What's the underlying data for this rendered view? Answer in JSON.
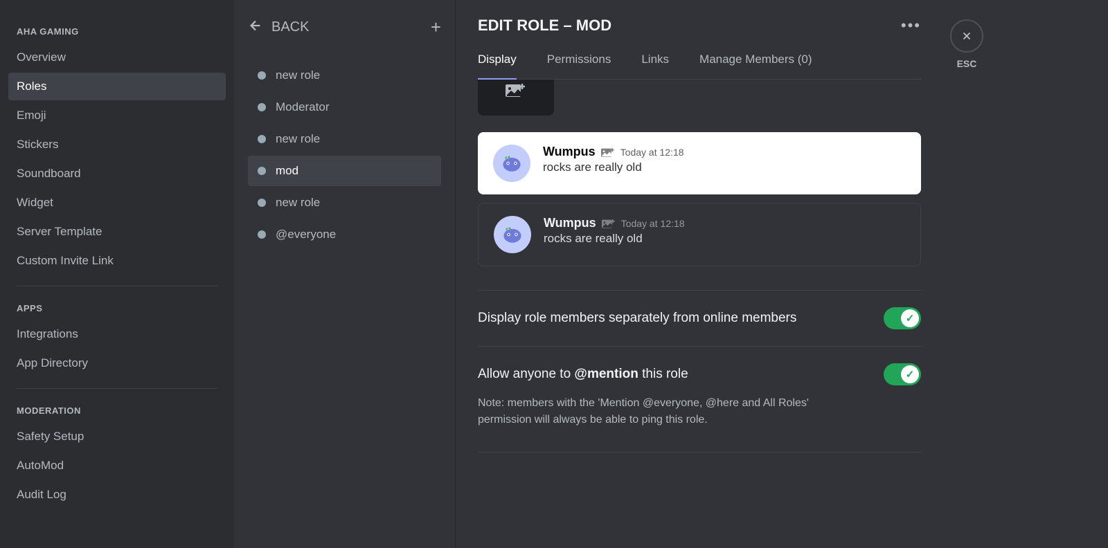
{
  "sidebar": {
    "sections": [
      {
        "title": "AHA GAMING",
        "items": [
          {
            "label": "Overview",
            "active": false
          },
          {
            "label": "Roles",
            "active": true
          },
          {
            "label": "Emoji",
            "active": false
          },
          {
            "label": "Stickers",
            "active": false
          },
          {
            "label": "Soundboard",
            "active": false
          },
          {
            "label": "Widget",
            "active": false
          },
          {
            "label": "Server Template",
            "active": false
          },
          {
            "label": "Custom Invite Link",
            "active": false
          }
        ]
      },
      {
        "title": "APPS",
        "items": [
          {
            "label": "Integrations",
            "active": false
          },
          {
            "label": "App Directory",
            "active": false
          }
        ]
      },
      {
        "title": "MODERATION",
        "items": [
          {
            "label": "Safety Setup",
            "active": false
          },
          {
            "label": "AutoMod",
            "active": false
          },
          {
            "label": "Audit Log",
            "active": false
          }
        ]
      }
    ]
  },
  "rolesColumn": {
    "backLabel": "BACK",
    "roles": [
      {
        "name": "new role",
        "active": false
      },
      {
        "name": "Moderator",
        "active": false
      },
      {
        "name": "new role",
        "active": false
      },
      {
        "name": "mod",
        "active": true
      },
      {
        "name": "new role",
        "active": false
      },
      {
        "name": "@everyone",
        "active": false
      }
    ]
  },
  "main": {
    "title": "EDIT ROLE – MOD",
    "tabs": [
      {
        "label": "Display",
        "active": true
      },
      {
        "label": "Permissions",
        "active": false
      },
      {
        "label": "Links",
        "active": false
      },
      {
        "label": "Manage Members (0)",
        "active": false
      }
    ],
    "preview": {
      "username": "Wumpus",
      "timestamp": "Today at 12:18",
      "message": "rocks are really old"
    },
    "settings": {
      "displaySeparately": {
        "label": "Display role members separately from online members",
        "enabled": true
      },
      "allowMention": {
        "labelPrefix": "Allow anyone to ",
        "labelBold": "@mention",
        "labelSuffix": " this role",
        "note": "Note: members with the 'Mention @everyone, @here and All Roles' permission will always be able to ping this role.",
        "enabled": true
      }
    },
    "closeLabel": "ESC"
  }
}
